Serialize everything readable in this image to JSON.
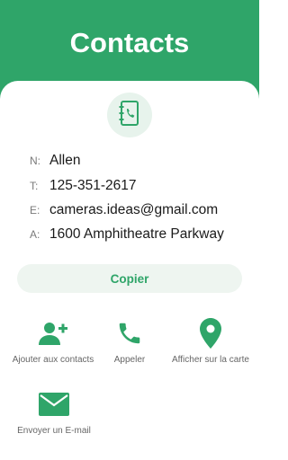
{
  "header": {
    "title": "Contacts"
  },
  "contact": {
    "name_key": "N:",
    "name": "Allen",
    "phone_key": "T:",
    "phone": "125-351-2617",
    "email_key": "E:",
    "email": "cameras.ideas@gmail.com",
    "address_key": "A:",
    "address": "1600 Amphitheatre Parkway"
  },
  "copy_label": "Copier",
  "actions": {
    "add_contact": "Ajouter aux contacts",
    "call": "Appeler",
    "map": "Afficher sur la carte",
    "email": "Envoyer un E-mail"
  },
  "colors": {
    "accent": "#2fa569",
    "soft": "#e7f3ec"
  },
  "icons": [
    "address-book-icon",
    "add-person-icon",
    "phone-icon",
    "map-pin-icon",
    "mail-icon"
  ]
}
